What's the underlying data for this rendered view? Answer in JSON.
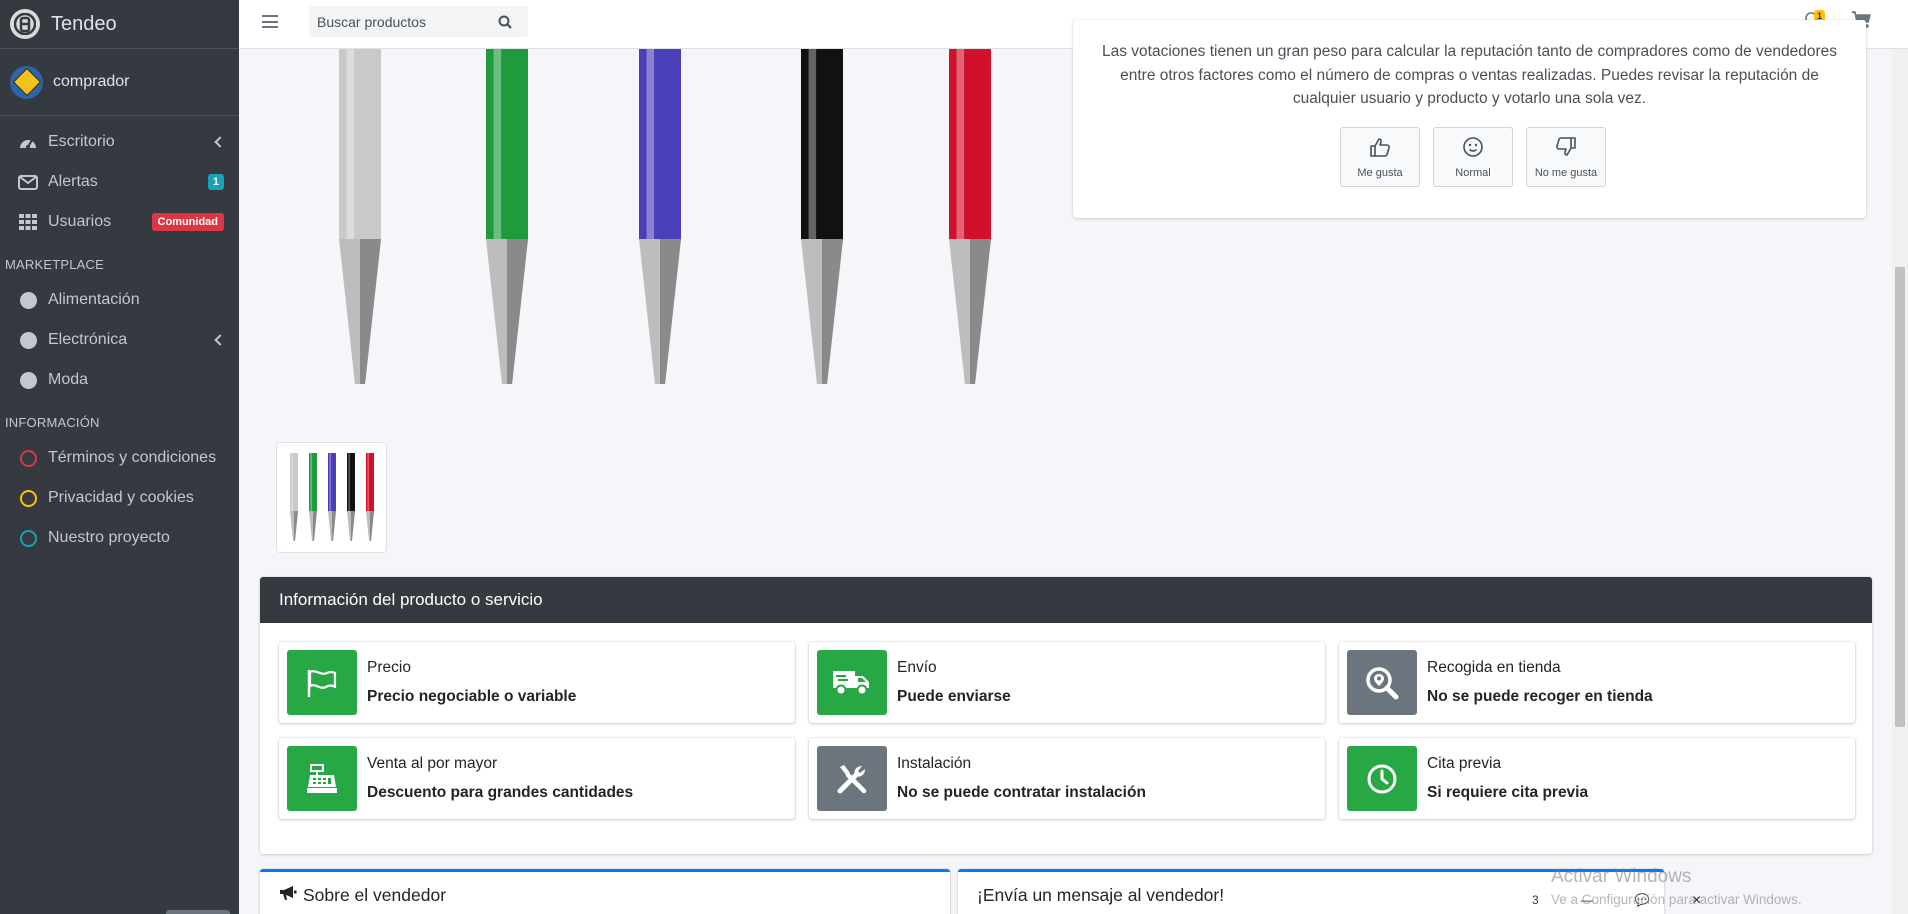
{
  "app": {
    "brand_name": "Tendeo"
  },
  "user": {
    "name": "comprador"
  },
  "sidebar": {
    "items": [
      {
        "label": "Escritorio",
        "icon": "tachometer-icon",
        "chevron": true
      },
      {
        "label": "Alertas",
        "icon": "envelope-icon",
        "badge": "1"
      },
      {
        "label": "Usuarios",
        "icon": "grid-icon",
        "badge": "Comunidad"
      }
    ],
    "marketplace_header": "MARKETPLACE",
    "marketplace": [
      {
        "label": "Alimentación"
      },
      {
        "label": "Electrónica",
        "chevron": true
      },
      {
        "label": "Moda"
      }
    ],
    "info_header": "INFORMACIÓN",
    "info": [
      {
        "label": "Términos y condiciones",
        "color": "#dc3545"
      },
      {
        "label": "Privacidad y cookies",
        "color": "#ffc107"
      },
      {
        "label": "Nuestro proyecto",
        "color": "#17a2b8"
      }
    ]
  },
  "topbar": {
    "search_placeholder": "Buscar productos",
    "notification_count": "1"
  },
  "vote": {
    "text": "Las votaciones tienen un gran peso para calcular la reputación tanto de compradores como de vendedores entre otros factores como el número de compras o ventas realizadas. Puedes revisar la reputación de cualquier usuario y producto y votarlo una sola vez.",
    "buttons": [
      "Me gusta",
      "Normal",
      "No me gusta"
    ]
  },
  "product": {
    "pen_colors": [
      "#c9c9c9",
      "#1f9a3c",
      "#4a3fb8",
      "#111111",
      "#d1112b"
    ]
  },
  "info_section": {
    "title": "Información del producto o servicio",
    "boxes": [
      {
        "title": "Precio",
        "value": "Precio negociable o variable",
        "icon": "flag-icon",
        "color": "green"
      },
      {
        "title": "Envío",
        "value": "Puede enviarse",
        "icon": "truck-icon",
        "color": "green"
      },
      {
        "title": "Recogida en tienda",
        "value": "No se puede recoger en tienda",
        "icon": "search-location-icon",
        "color": "gray"
      },
      {
        "title": "Venta al por mayor",
        "value": "Descuento para grandes cantidades",
        "icon": "cash-register-icon",
        "color": "green"
      },
      {
        "title": "Instalación",
        "value": "No se puede contratar instalación",
        "icon": "tools-icon",
        "color": "gray"
      },
      {
        "title": "Cita previa",
        "value": "Si requiere cita previa",
        "icon": "clock-icon",
        "color": "green"
      }
    ]
  },
  "bottom": {
    "seller_title": "Sobre el vendedor",
    "message_title": "¡Envía un mensaje al vendedor!",
    "chat_count": "3"
  },
  "watermark": {
    "title": "Activar Windows",
    "subtitle": "Ve a Configuración para activar Windows."
  }
}
